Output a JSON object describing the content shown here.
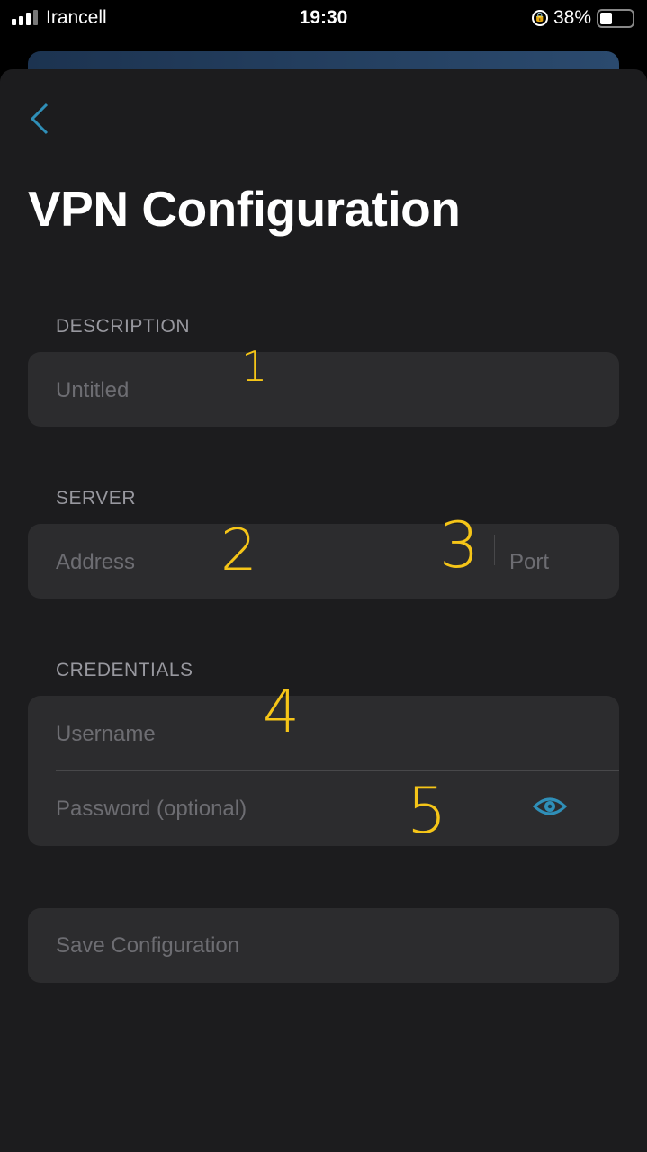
{
  "status_bar": {
    "carrier": "Irancell",
    "time": "19:30",
    "battery": "38%",
    "battery_level": 0.38
  },
  "page": {
    "title": "VPN Configuration",
    "back_icon": "chevron-left-icon"
  },
  "description": {
    "label": "DESCRIPTION",
    "placeholder": "Untitled"
  },
  "server": {
    "label": "SERVER",
    "address_placeholder": "Address",
    "port_placeholder": "Port"
  },
  "credentials": {
    "label": "CREDENTIALS",
    "username_placeholder": "Username",
    "password_placeholder": "Password (optional)",
    "reveal_icon": "eye-icon"
  },
  "save_label": "Save Configuration",
  "annotations": [
    "1",
    "2",
    "3",
    "4",
    "5"
  ],
  "colors": {
    "accent": "#2f8fb8",
    "background": "#1c1c1e",
    "field": "#2c2c2e",
    "annotation": "#f5c518"
  }
}
